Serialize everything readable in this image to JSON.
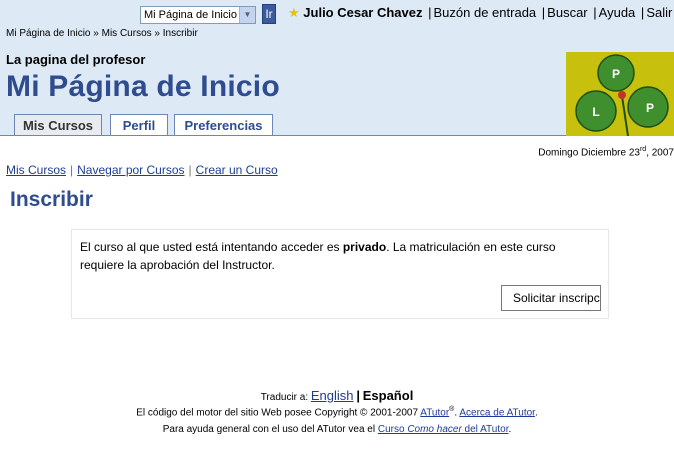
{
  "topbar": {
    "jump_select_value": "Mi Página de Inicio",
    "jump_button_label": "Ir",
    "user_name": "Julio Cesar Chavez",
    "nav": [
      "Buzón de entrada",
      "Buscar",
      "Ayuda",
      "Salir"
    ]
  },
  "breadcrumb": [
    "Mi Página de Inicio",
    "Mis Cursos",
    "Inscribir"
  ],
  "header": {
    "course_owner": "La pagina del profesor",
    "site_title": "Mi Página de Inicio",
    "logo_letters": [
      "P",
      "L",
      "P"
    ],
    "tabs": [
      {
        "label": "Mis Cursos",
        "active": true
      },
      {
        "label": "Perfil",
        "active": false
      },
      {
        "label": "Preferencias",
        "active": false
      }
    ]
  },
  "date": {
    "text": "Domingo Diciembre 23",
    "suffix": "rd",
    "year": ", 2007"
  },
  "subnav": [
    "Mis Cursos",
    "Navegar por Cursos",
    "Crear un Curso"
  ],
  "page_heading": "Inscribir",
  "message": {
    "part1": "El curso al que usted está intentando acceder es ",
    "bold": "privado",
    "part2": ". La matriculación en este curso requiere la aprobación del Instructor.",
    "button_label": "Solicitar inscripción"
  },
  "footer": {
    "translate_label": "Traducir a:",
    "languages": [
      "English",
      "Español"
    ],
    "copyright_prefix": "El código del motor del sitio Web posee Copyright © 2001-2007 ",
    "atutor_link": "ATutor",
    "atutor_sup": "®",
    "about_link": "Acerca de ATutor",
    "help_prefix": "Para ayuda general con el uso del ATutor vea el ",
    "help_link_1": "Curso ",
    "help_link_em": "Como hacer",
    "help_link_2": " del ATutor"
  },
  "colors": {
    "header_bg": "#dde9f5",
    "title_blue": "#2e4c8e",
    "link_blue": "#1e3c94",
    "logo_bg": "#c7c10e",
    "leaf_green": "#3f8f2f"
  }
}
